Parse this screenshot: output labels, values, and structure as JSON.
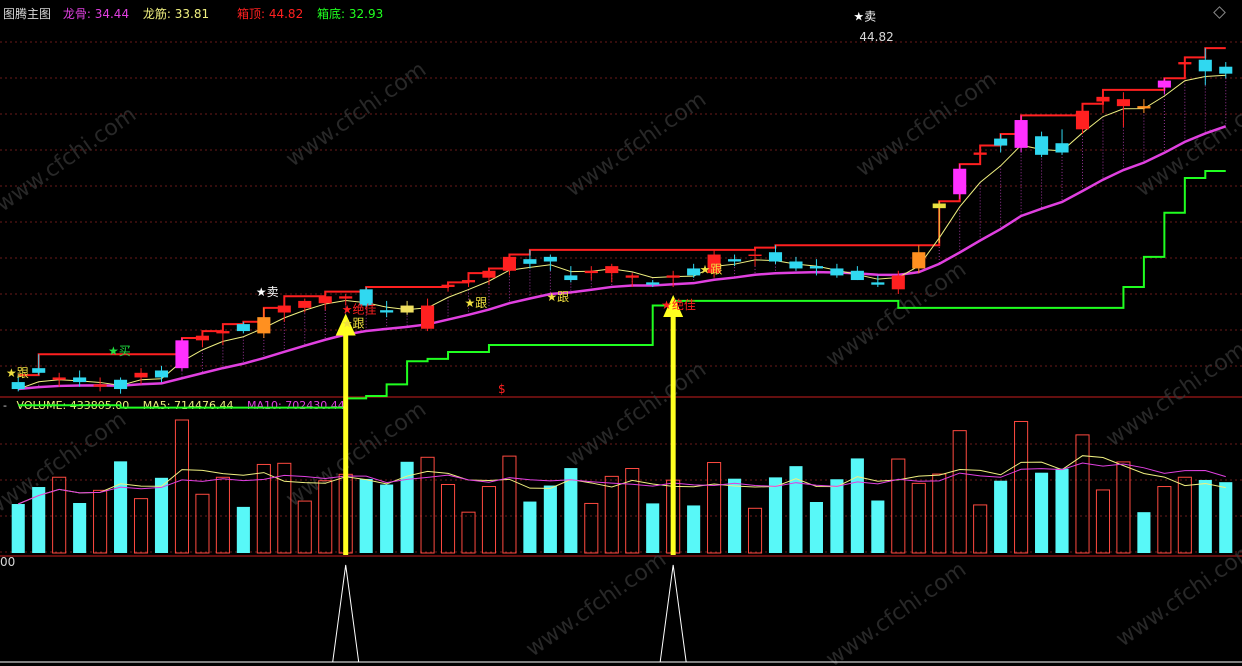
{
  "header": {
    "title": "图腾主图",
    "items": [
      {
        "label": "龙骨:",
        "value": "34.44",
        "color": "#e040e0"
      },
      {
        "label": "龙筋:",
        "value": "33.81",
        "color": "#f0f080"
      },
      {
        "label": "箱顶:",
        "value": "44.82",
        "color": "#ff2020"
      },
      {
        "label": "箱底:",
        "value": "32.93",
        "color": "#20ff20"
      }
    ]
  },
  "volume_header": {
    "dash": "-",
    "items": [
      {
        "label": "VOLUME:",
        "value": "433805.00",
        "color": "#f0f080"
      },
      {
        "label": "MA5:",
        "value": "714476.44",
        "color": "#f0f080"
      },
      {
        "label": "MA10:",
        "value": "702430.44",
        "color": "#e040e0"
      }
    ]
  },
  "signals": {
    "gen": "★跟",
    "mai": "★买",
    "sell": "★卖",
    "jue": "★绝佳",
    "top_price": "44.82",
    "dollar": "$",
    "vol_scale": "00"
  },
  "watermark": "www.cfchi.com",
  "colors": {
    "bg": "#000000",
    "grid": "#6a1a1a",
    "divider": "#a01818",
    "up": "#ff2020",
    "down": "#30d8f0",
    "volume_up": "#ff4a40",
    "volume_down": "#58f8f8",
    "longgu": "#e040e0",
    "longjin": "#f0f080",
    "box_top": "#ff2020",
    "box_bottom": "#20ff20",
    "arrow": "#ffff20"
  },
  "chart_data": {
    "type": "candlestick",
    "candle_count": 60,
    "price_range": [
      29.8,
      46.1
    ],
    "candles": [
      {
        "o": 30.4,
        "h": 30.7,
        "l": 30.0,
        "c": 30.1
      },
      {
        "o": 31.0,
        "h": 31.6,
        "l": 30.7,
        "c": 30.8
      },
      {
        "o": 30.5,
        "h": 30.8,
        "l": 30.2,
        "c": 30.6
      },
      {
        "o": 30.6,
        "h": 30.9,
        "l": 30.2,
        "c": 30.4
      },
      {
        "o": 30.2,
        "h": 30.6,
        "l": 30.0,
        "c": 30.3
      },
      {
        "o": 30.5,
        "h": 30.6,
        "l": 29.9,
        "c": 30.1
      },
      {
        "o": 30.6,
        "h": 31.0,
        "l": 30.3,
        "c": 30.8
      },
      {
        "o": 30.9,
        "h": 31.1,
        "l": 30.4,
        "c": 30.6
      },
      {
        "o": 31.0,
        "h": 32.3,
        "l": 30.9,
        "c": 32.2
      },
      {
        "o": 32.2,
        "h": 32.6,
        "l": 31.9,
        "c": 32.4
      },
      {
        "o": 32.5,
        "h": 32.9,
        "l": 32.0,
        "c": 32.6
      },
      {
        "o": 32.9,
        "h": 33.0,
        "l": 32.5,
        "c": 32.6
      },
      {
        "o": 32.5,
        "h": 33.6,
        "l": 32.3,
        "c": 33.2
      },
      {
        "o": 33.4,
        "h": 34.1,
        "l": 33.0,
        "c": 33.7
      },
      {
        "o": 33.6,
        "h": 34.0,
        "l": 33.4,
        "c": 33.9
      },
      {
        "o": 33.8,
        "h": 34.3,
        "l": 33.5,
        "c": 34.1
      },
      {
        "o": 34.0,
        "h": 34.2,
        "l": 33.7,
        "c": 34.1
      },
      {
        "o": 34.4,
        "h": 34.5,
        "l": 33.6,
        "c": 33.7
      },
      {
        "o": 33.5,
        "h": 33.9,
        "l": 33.2,
        "c": 33.4
      },
      {
        "o": 33.7,
        "h": 33.9,
        "l": 33.3,
        "c": 33.4
      },
      {
        "o": 32.7,
        "h": 34.0,
        "l": 32.6,
        "c": 33.7
      },
      {
        "o": 34.5,
        "h": 34.7,
        "l": 34.3,
        "c": 34.6
      },
      {
        "o": 34.7,
        "h": 35.1,
        "l": 34.5,
        "c": 34.8
      },
      {
        "o": 34.9,
        "h": 35.3,
        "l": 34.6,
        "c": 35.2
      },
      {
        "o": 35.2,
        "h": 35.9,
        "l": 35.0,
        "c": 35.8
      },
      {
        "o": 35.7,
        "h": 36.1,
        "l": 35.3,
        "c": 35.5
      },
      {
        "o": 35.8,
        "h": 35.9,
        "l": 35.2,
        "c": 35.6
      },
      {
        "o": 35.0,
        "h": 35.4,
        "l": 34.7,
        "c": 34.8
      },
      {
        "o": 35.1,
        "h": 35.4,
        "l": 34.8,
        "c": 35.2
      },
      {
        "o": 35.1,
        "h": 35.5,
        "l": 34.7,
        "c": 35.4
      },
      {
        "o": 34.9,
        "h": 35.1,
        "l": 34.5,
        "c": 35.0
      },
      {
        "o": 34.7,
        "h": 34.8,
        "l": 34.5,
        "c": 34.6
      },
      {
        "o": 34.9,
        "h": 35.2,
        "l": 34.5,
        "c": 35.0
      },
      {
        "o": 35.3,
        "h": 35.5,
        "l": 34.9,
        "c": 35.0
      },
      {
        "o": 35.1,
        "h": 36.1,
        "l": 34.9,
        "c": 35.9
      },
      {
        "o": 35.7,
        "h": 35.9,
        "l": 35.4,
        "c": 35.6
      },
      {
        "o": 35.9,
        "h": 36.2,
        "l": 35.4,
        "c": 35.9
      },
      {
        "o": 36.0,
        "h": 36.3,
        "l": 35.5,
        "c": 35.6
      },
      {
        "o": 35.6,
        "h": 35.8,
        "l": 35.2,
        "c": 35.3
      },
      {
        "o": 35.4,
        "h": 35.7,
        "l": 35.0,
        "c": 35.3
      },
      {
        "o": 35.3,
        "h": 35.5,
        "l": 34.9,
        "c": 35.0
      },
      {
        "o": 35.2,
        "h": 35.4,
        "l": 34.8,
        "c": 34.8
      },
      {
        "o": 34.7,
        "h": 35.0,
        "l": 34.5,
        "c": 34.6
      },
      {
        "o": 34.4,
        "h": 35.2,
        "l": 34.2,
        "c": 35.0
      },
      {
        "o": 35.3,
        "h": 36.3,
        "l": 35.1,
        "c": 36.0
      },
      {
        "o": 37.9,
        "h": 38.2,
        "l": 36.4,
        "c": 38.1
      },
      {
        "o": 38.5,
        "h": 39.8,
        "l": 38.3,
        "c": 39.6
      },
      {
        "o": 40.2,
        "h": 40.6,
        "l": 39.8,
        "c": 40.3
      },
      {
        "o": 40.9,
        "h": 41.1,
        "l": 40.3,
        "c": 40.6
      },
      {
        "o": 40.5,
        "h": 41.9,
        "l": 40.3,
        "c": 41.7
      },
      {
        "o": 41.0,
        "h": 41.2,
        "l": 40.1,
        "c": 40.2
      },
      {
        "o": 40.7,
        "h": 41.3,
        "l": 40.2,
        "c": 40.3
      },
      {
        "o": 41.3,
        "h": 42.4,
        "l": 41.1,
        "c": 42.1
      },
      {
        "o": 42.5,
        "h": 43.0,
        "l": 42.0,
        "c": 42.7
      },
      {
        "o": 42.3,
        "h": 42.9,
        "l": 41.4,
        "c": 42.6
      },
      {
        "o": 42.3,
        "h": 42.6,
        "l": 42.0,
        "c": 42.2
      },
      {
        "o": 43.1,
        "h": 43.5,
        "l": 42.8,
        "c": 43.4
      },
      {
        "o": 44.1,
        "h": 44.4,
        "l": 43.8,
        "c": 44.2
      },
      {
        "o": 44.3,
        "h": 44.8,
        "l": 43.2,
        "c": 43.8
      },
      {
        "o": 44.0,
        "h": 44.2,
        "l": 43.5,
        "c": 43.7
      }
    ]
  }
}
